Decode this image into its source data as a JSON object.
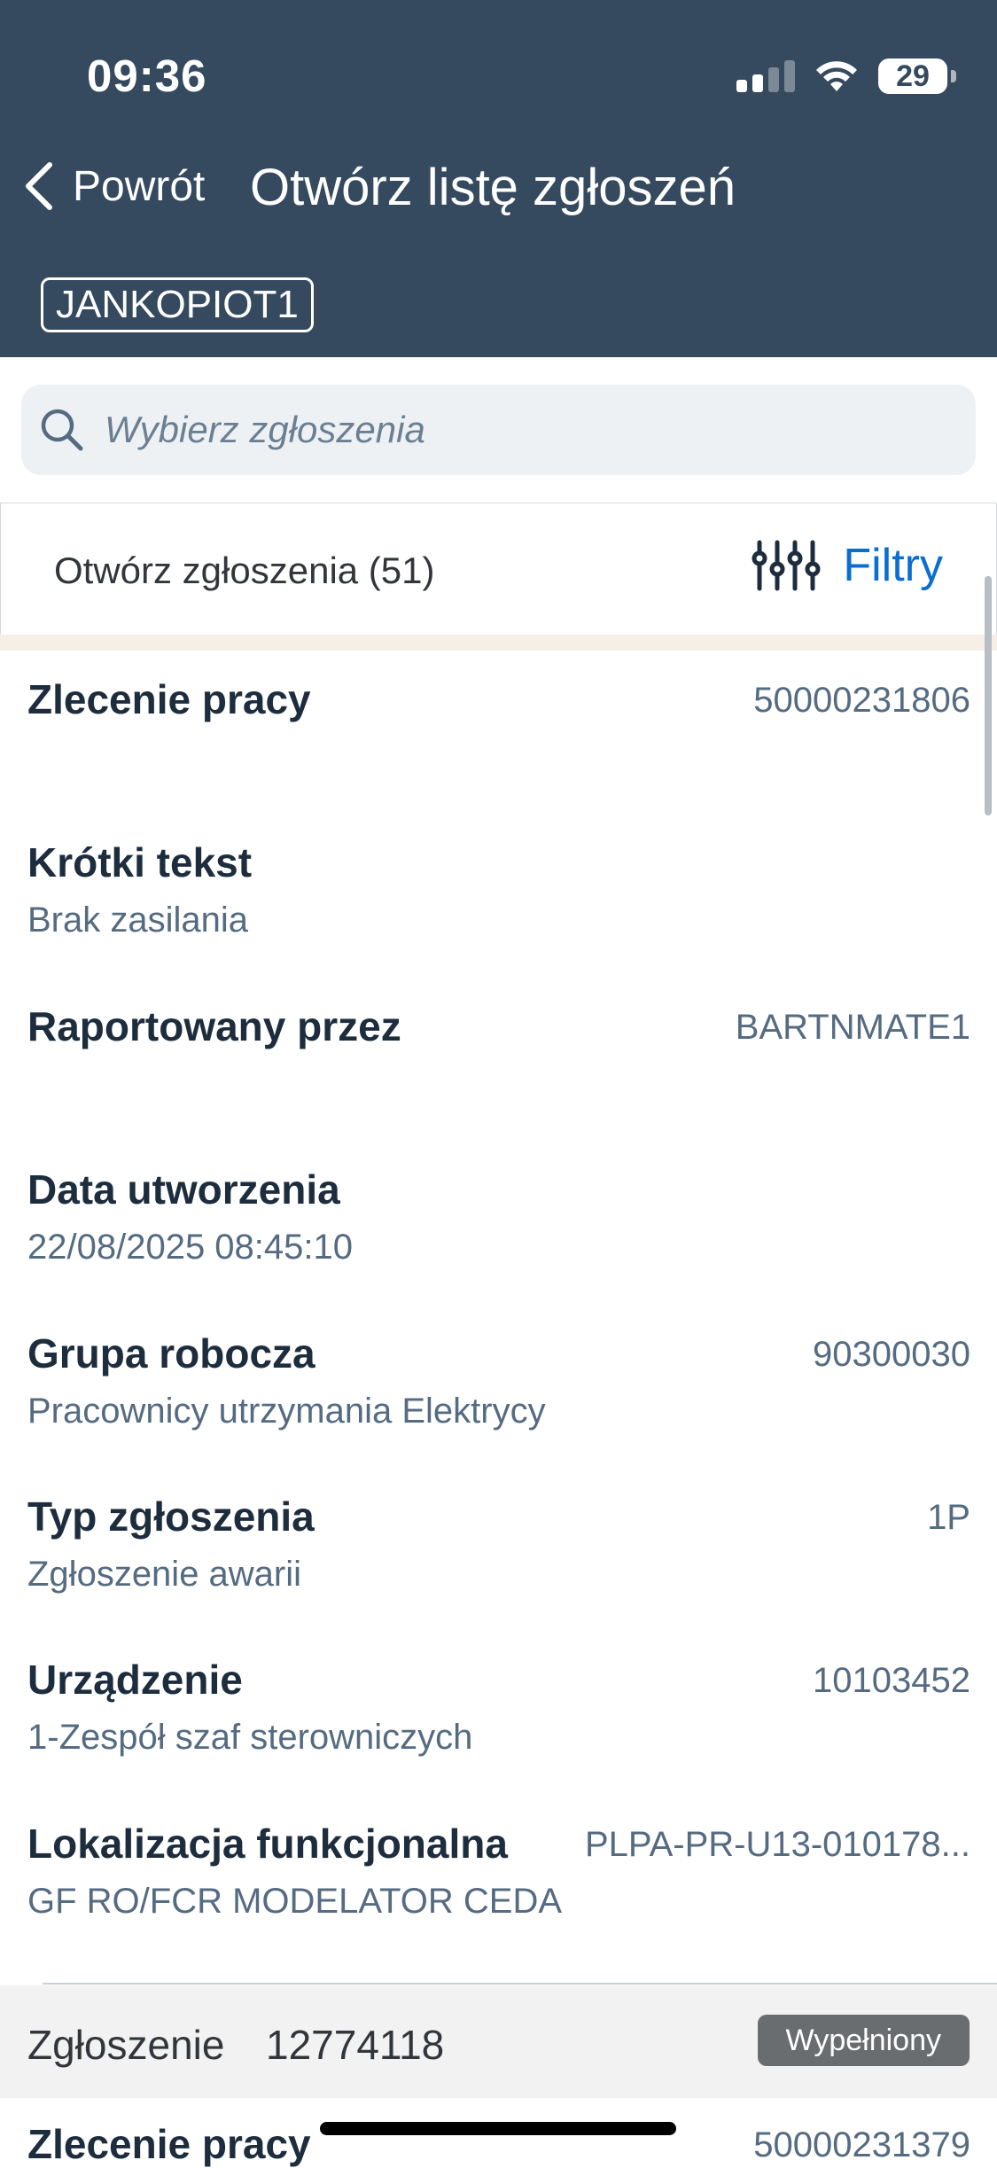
{
  "status_bar": {
    "time": "09:36",
    "battery": "29"
  },
  "nav": {
    "back_label": "Powrót",
    "title": "Otwórz listę zgłoszeń",
    "user": "JANKOPIOT1"
  },
  "search": {
    "placeholder": "Wybierz zgłoszenia"
  },
  "list_header": {
    "count_label": "Otwórz zgłoszenia (51)",
    "filters_label": "Filtry"
  },
  "item": {
    "rows": [
      {
        "label": "Zlecenie pracy",
        "value": "50000231806",
        "sub": ""
      },
      {
        "label": "Krótki tekst",
        "value": "",
        "sub": "Brak zasilania"
      },
      {
        "label": "Raportowany przez",
        "value": "BARTNMATE1",
        "sub": ""
      },
      {
        "label": "Data utworzenia",
        "value": "",
        "sub": "22/08/2025 08:45:10"
      },
      {
        "label": "Grupa robocza",
        "value": "90300030",
        "sub": "Pracownicy utrzymania Elektrycy"
      },
      {
        "label": "Typ zgłoszenia",
        "value": "1P",
        "sub": "Zgłoszenie awarii"
      },
      {
        "label": "Urządzenie",
        "value": "10103452",
        "sub": "1-Zespół szaf sterowniczych"
      },
      {
        "label": "Lokalizacja funkcjonalna",
        "value": "PLPA-PR-U13-010178...",
        "sub": "GF RO/FCR MODELATOR CEDA"
      }
    ]
  },
  "next_item": {
    "label": "Zgłoszenie",
    "id": "12774118",
    "status": "Wypełniony",
    "first_row_label": "Zlecenie pracy",
    "first_row_value": "50000231379"
  },
  "colors": {
    "header": "#354a5f",
    "accent": "#0a6ed1",
    "badge": "#6a6d70"
  }
}
